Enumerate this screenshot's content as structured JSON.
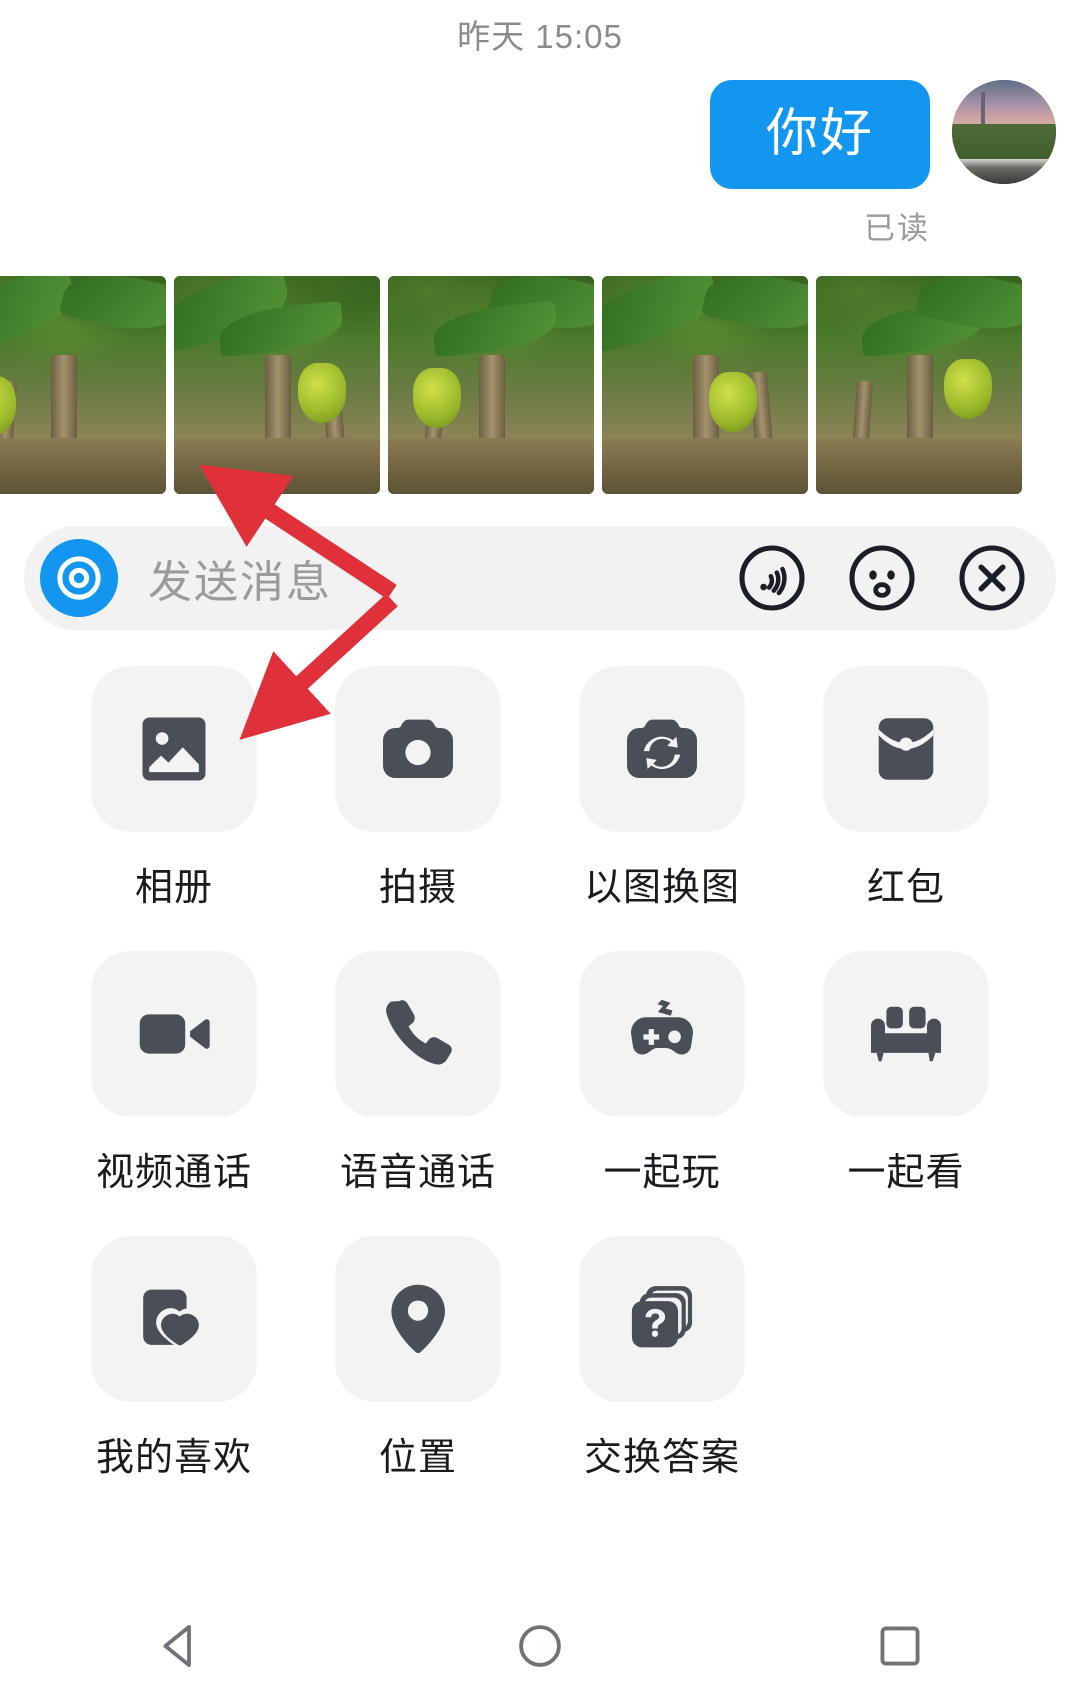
{
  "chat": {
    "timestamp": "昨天 15:05",
    "outgoing_message": "你好",
    "read_status": "已读",
    "avatar_name": "sunset-road-avatar",
    "bubble_color": "#1296f0"
  },
  "photo_strip": {
    "name": "banana-plantation-photo-strip",
    "photos": [
      {
        "alt": "banana-plantation-1"
      },
      {
        "alt": "banana-plantation-2"
      },
      {
        "alt": "banana-plantation-3"
      },
      {
        "alt": "banana-plantation-4"
      },
      {
        "alt": "banana-plantation-5"
      }
    ]
  },
  "input_bar": {
    "placeholder": "发送消息",
    "voice_icon": "voice-record-icon",
    "icons": [
      {
        "name": "voice-wave-icon"
      },
      {
        "name": "emoji-face-icon"
      },
      {
        "name": "close-circle-icon"
      }
    ]
  },
  "panel": {
    "rows": [
      [
        {
          "icon": "gallery-icon",
          "label": "相册"
        },
        {
          "icon": "camera-icon",
          "label": "拍摄"
        },
        {
          "icon": "image-swap-icon",
          "label": "以图换图"
        },
        {
          "icon": "red-packet-icon",
          "label": "红包"
        }
      ],
      [
        {
          "icon": "video-call-icon",
          "label": "视频通话"
        },
        {
          "icon": "voice-call-icon",
          "label": "语音通话"
        },
        {
          "icon": "gamepad-icon",
          "label": "一起玩"
        },
        {
          "icon": "sofa-icon",
          "label": "一起看"
        }
      ],
      [
        {
          "icon": "favorites-heart-icon",
          "label": "我的喜欢"
        },
        {
          "icon": "location-pin-icon",
          "label": "位置"
        },
        {
          "icon": "question-cards-icon",
          "label": "交换答案"
        }
      ]
    ]
  },
  "annotations": {
    "arrow_color": "#e0313b",
    "arrows": [
      {
        "name": "arrow-to-photo-strip",
        "points_to": "photo-strip"
      },
      {
        "name": "arrow-to-gallery-tile",
        "points_to": "gallery-tile"
      }
    ]
  },
  "navbar": {
    "buttons": [
      {
        "name": "nav-back-button",
        "icon": "triangle-back-icon"
      },
      {
        "name": "nav-home-button",
        "icon": "circle-home-icon"
      },
      {
        "name": "nav-recents-button",
        "icon": "square-recents-icon"
      }
    ]
  }
}
